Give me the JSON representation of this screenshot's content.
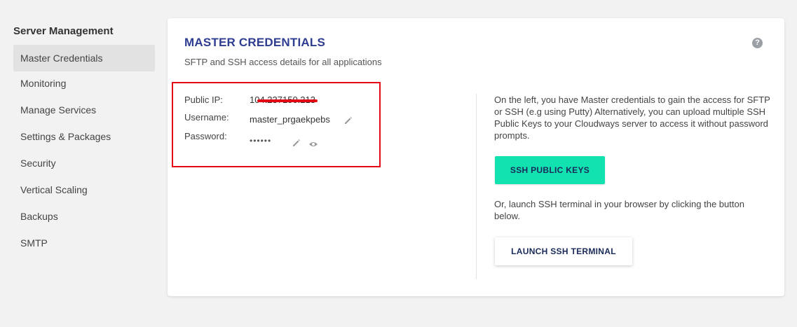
{
  "sidebar": {
    "title": "Server Management",
    "items": [
      {
        "label": "Master Credentials",
        "active": true
      },
      {
        "label": "Monitoring"
      },
      {
        "label": "Manage Services"
      },
      {
        "label": "Settings & Packages"
      },
      {
        "label": "Security"
      },
      {
        "label": "Vertical Scaling"
      },
      {
        "label": "Backups"
      },
      {
        "label": "SMTP"
      }
    ]
  },
  "card": {
    "title": "MASTER CREDENTIALS",
    "subtitle": "SFTP and SSH access details for all applications",
    "help_icon": "?",
    "credentials": {
      "public_ip_label": "Public IP:",
      "public_ip_value": "104.237150.213",
      "username_label": "Username:",
      "username_value": "master_prgaekpebs",
      "password_label": "Password:",
      "password_value": "••••••"
    },
    "right": {
      "description": "On the left, you have Master credentials to gain the access for SFTP or SSH (e.g using Putty) Alternatively, you can upload multiple SSH Public Keys to your Cloudways server to access it without password prompts.",
      "ssh_keys_button": "SSH PUBLIC KEYS",
      "terminal_text": "Or, launch SSH terminal in your browser by clicking the button below.",
      "terminal_button": "LAUNCH SSH TERMINAL"
    }
  },
  "colors": {
    "title": "#2f3d91",
    "accent_button": "#12e1b0",
    "highlight": "#e30613"
  },
  "icons": {
    "edit": "pencil-icon",
    "view": "eye-icon",
    "help": "question-circle-icon"
  }
}
